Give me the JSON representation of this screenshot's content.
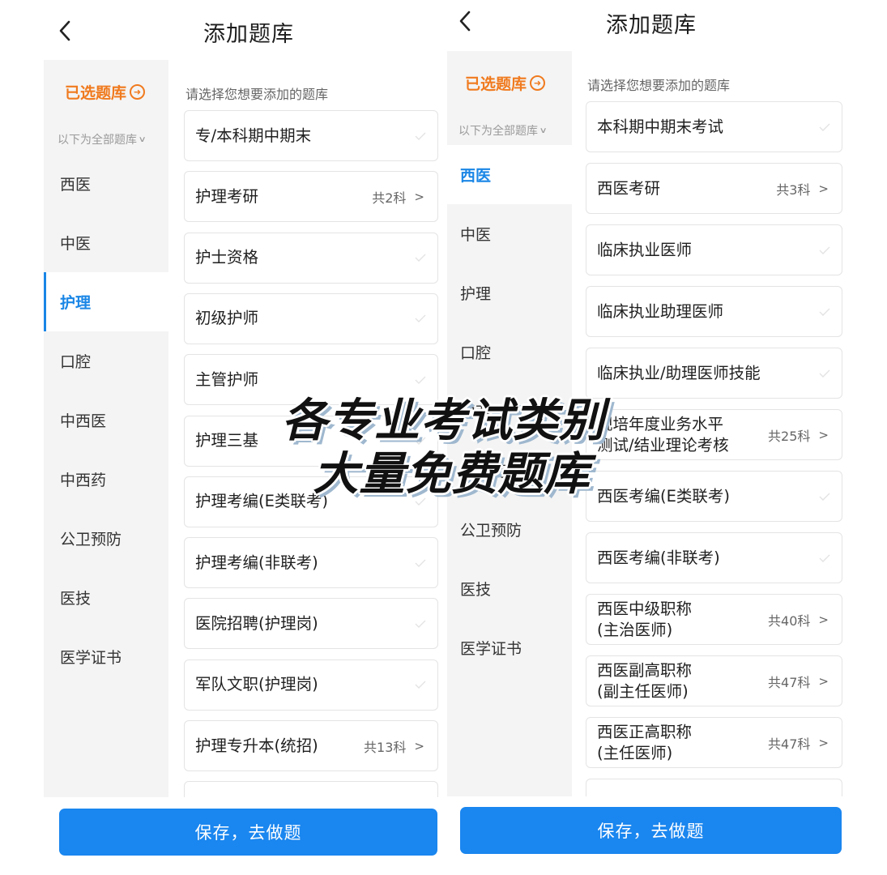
{
  "left": {
    "title": "添加题库",
    "selected_label": "已选题库",
    "all_label": "以下为全部题库",
    "instruction": "请选择您想要添加的题库",
    "save_label": "保存，去做题",
    "categories": [
      "西医",
      "中医",
      "护理",
      "口腔",
      "中西医",
      "中西药",
      "公卫预防",
      "医技",
      "医学证书"
    ],
    "active_category": "护理",
    "cards": [
      {
        "name": "专/本科期中期末",
        "count": ""
      },
      {
        "name": "护理考研",
        "count": "共2科"
      },
      {
        "name": "护士资格",
        "count": ""
      },
      {
        "name": "初级护师",
        "count": ""
      },
      {
        "name": "主管护师",
        "count": ""
      },
      {
        "name": "护理三基",
        "count": ""
      },
      {
        "name": "护理考编(E类联考)",
        "count": ""
      },
      {
        "name": "护理考编(非联考)",
        "count": ""
      },
      {
        "name": "医院招聘(护理岗)",
        "count": ""
      },
      {
        "name": "军队文职(护理岗)",
        "count": ""
      },
      {
        "name": "护理专升本(统招)",
        "count": "共13科"
      }
    ]
  },
  "right": {
    "title": "添加题库",
    "selected_label": "已选题库",
    "all_label": "以下为全部题库",
    "instruction": "请选择您想要添加的题库",
    "save_label": "保存，去做题",
    "categories": [
      "西医",
      "中医",
      "护理",
      "口腔",
      "中西医",
      "中西药",
      "公卫预防",
      "医技",
      "医学证书"
    ],
    "active_category": "西医",
    "cards": [
      {
        "name": "本科期中期末考试",
        "count": ""
      },
      {
        "name": "西医考研",
        "count": "共3科"
      },
      {
        "name": "临床执业医师",
        "count": ""
      },
      {
        "name": "临床执业助理医师",
        "count": ""
      },
      {
        "name": "临床执业/助理医师技能",
        "count": ""
      },
      {
        "name": "规培年度业务水平\n测试/结业理论考核",
        "count": "共25科"
      },
      {
        "name": "西医考编(E类联考)",
        "count": ""
      },
      {
        "name": "西医考编(非联考)",
        "count": ""
      },
      {
        "name": "西医中级职称\n(主治医师)",
        "count": "共40科"
      },
      {
        "name": "西医副高职称\n(副主任医师)",
        "count": "共47科"
      },
      {
        "name": "西医正高职称\n(主任医师)",
        "count": "共47科"
      }
    ]
  },
  "overlay": {
    "line1": "各专业考试类别",
    "line2": "大量免费题库"
  },
  "icons": {
    "back": "chevron-left-icon",
    "selected": "arrow-circle-right-icon",
    "expand": "chevron-down-icon",
    "check": "check-icon",
    "more": "chevron-right-icon"
  },
  "colors": {
    "accent_blue": "#1a86ef",
    "orange": "#f07a1e",
    "sidebar_bg": "#f4f4f4"
  }
}
